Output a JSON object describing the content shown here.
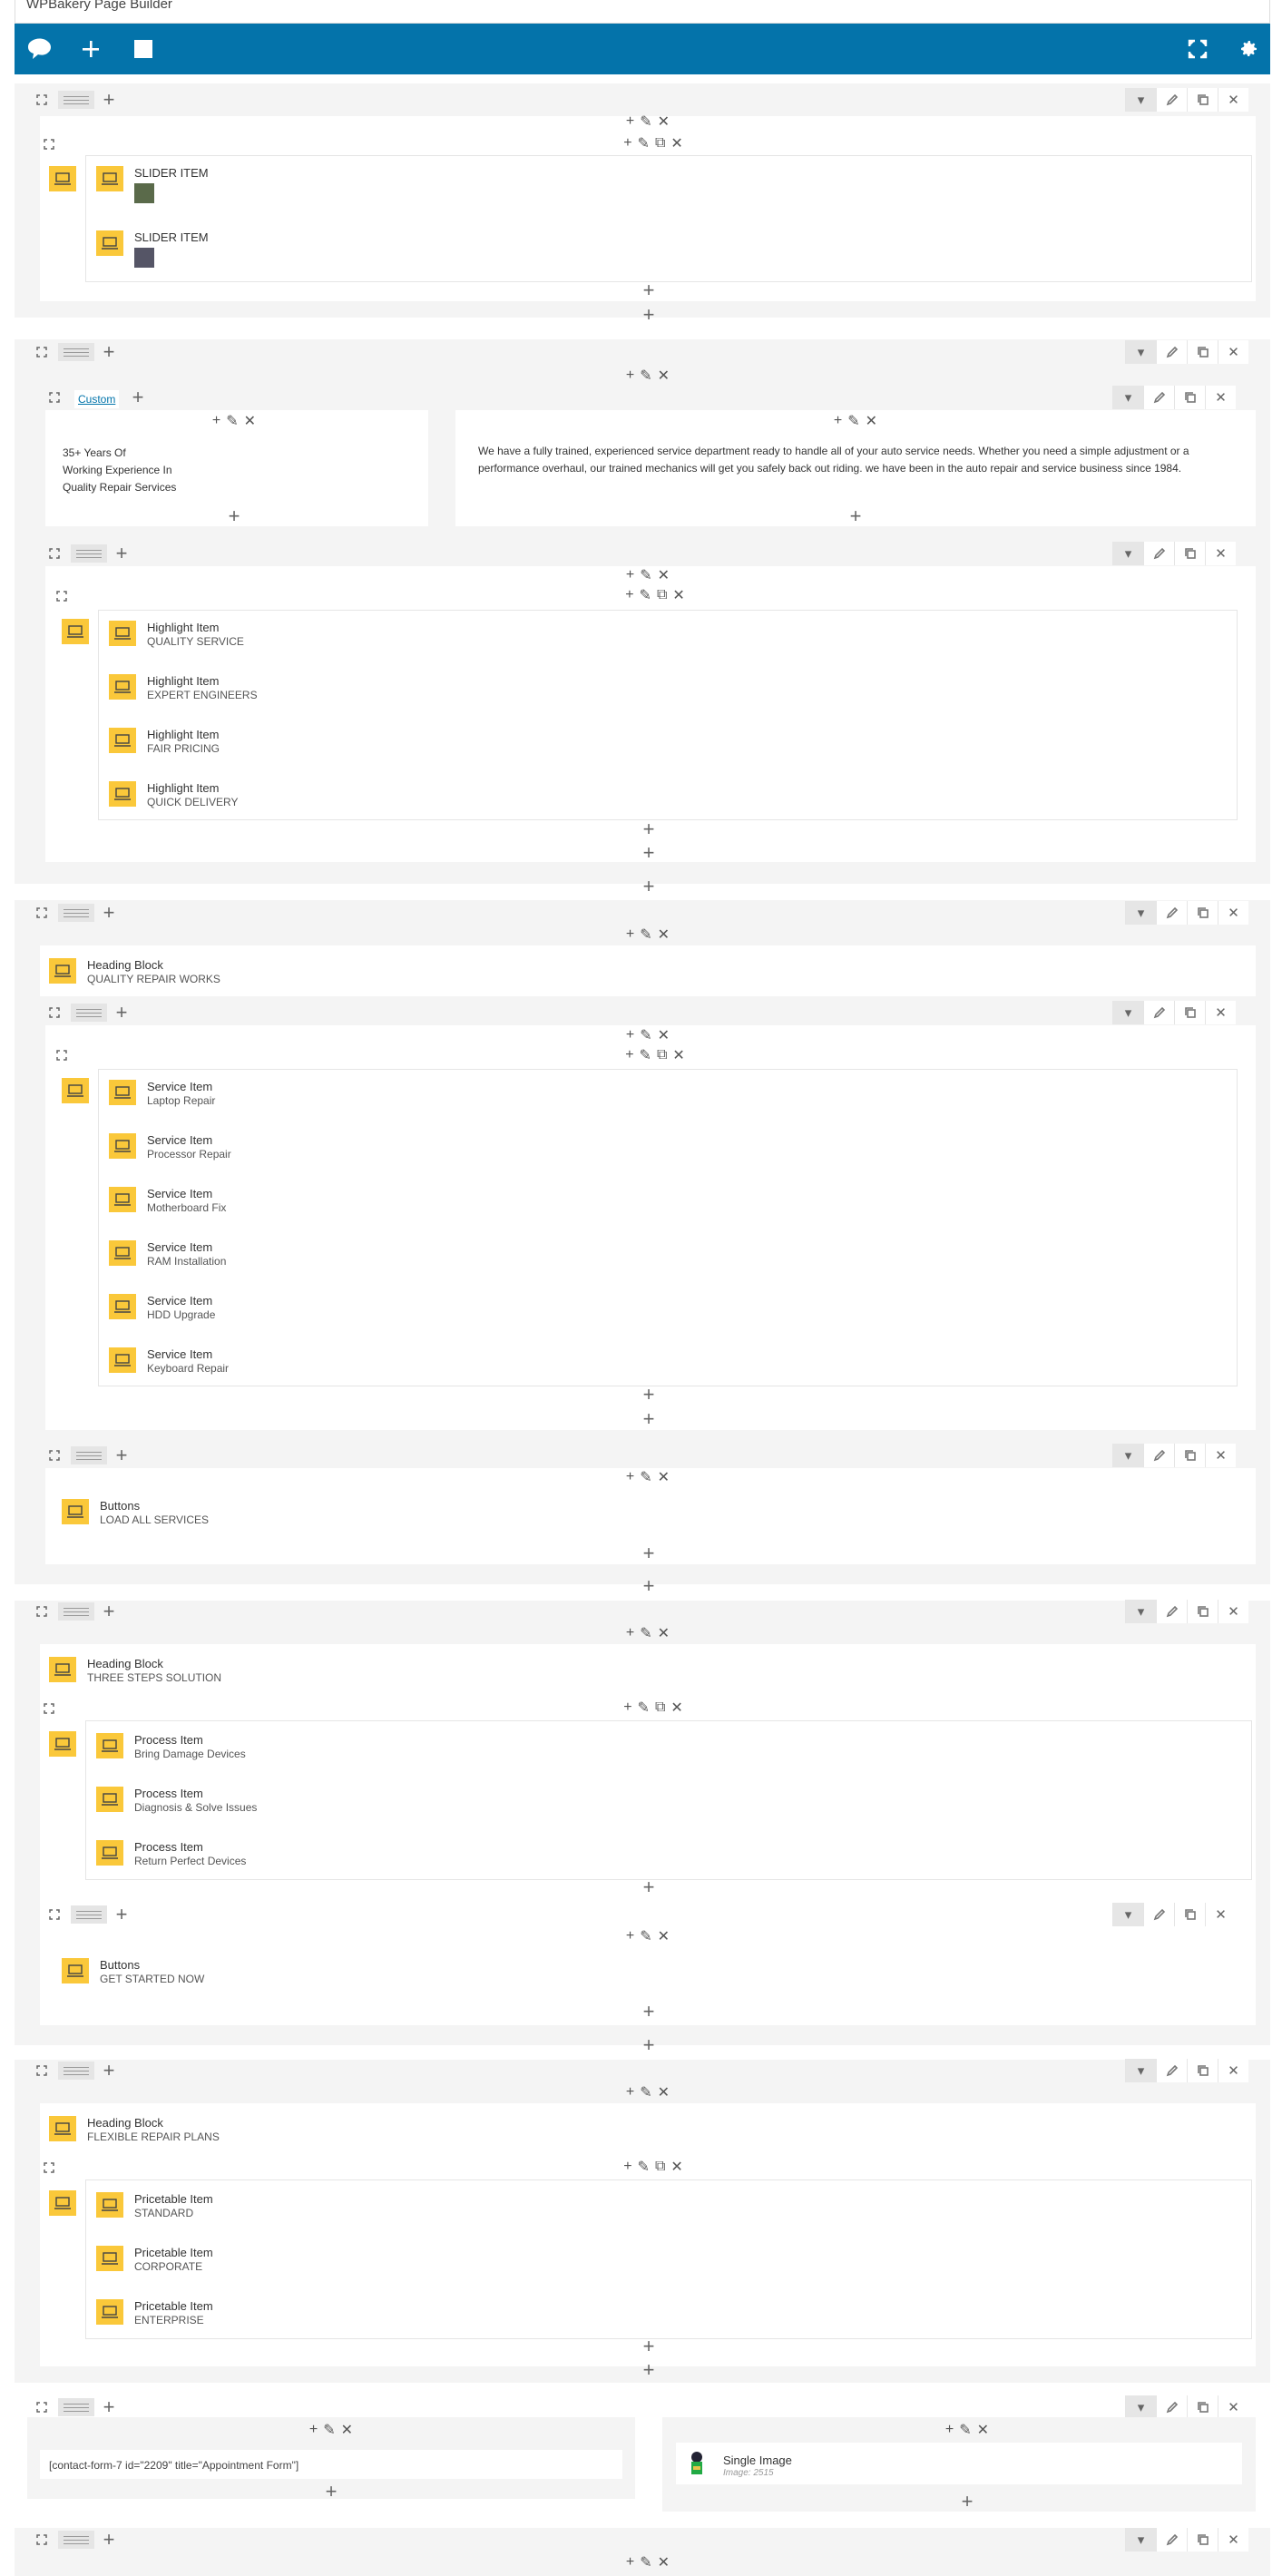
{
  "app": {
    "title": "WPBakery Page Builder"
  },
  "sliders": [
    {
      "label": "SLIDER ITEM"
    },
    {
      "label": "SLIDER ITEM"
    }
  ],
  "about": {
    "tab": "Custom",
    "left_text": [
      "35+ Years Of",
      "Working Experience In",
      "Quality Repair Services"
    ],
    "right_text": "We have a fully trained, experienced service department ready to handle all of your auto service needs. Whether you need a simple adjustment or a performance overhaul, our trained mechanics will get you safely back out riding. we have been in the auto repair and service business since 1984."
  },
  "highlights": [
    {
      "type": "Highlight Item",
      "title": "QUALITY SERVICE"
    },
    {
      "type": "Highlight Item",
      "title": "EXPERT ENGINEERS"
    },
    {
      "type": "Highlight Item",
      "title": "FAIR PRICING"
    },
    {
      "type": "Highlight Item",
      "title": "QUICK DELIVERY"
    }
  ],
  "heading1": {
    "type": "Heading Block",
    "title": "QUALITY REPAIR WORKS"
  },
  "services": [
    {
      "type": "Service Item",
      "title": "Laptop Repair"
    },
    {
      "type": "Service Item",
      "title": "Processor Repair"
    },
    {
      "type": "Service Item",
      "title": "Motherboard Fix"
    },
    {
      "type": "Service Item",
      "title": "RAM Installation"
    },
    {
      "type": "Service Item",
      "title": "HDD Upgrade"
    },
    {
      "type": "Service Item",
      "title": "Keyboard Repair"
    }
  ],
  "buttons1": {
    "type": "Buttons",
    "title": "LOAD ALL SERVICES"
  },
  "heading2": {
    "type": "Heading Block",
    "title": "THREE STEPS SOLUTION"
  },
  "process": [
    {
      "type": "Process Item",
      "title": "Bring Damage Devices"
    },
    {
      "type": "Process Item",
      "title": "Diagnosis & Solve Issues"
    },
    {
      "type": "Process Item",
      "title": "Return Perfect Devices"
    }
  ],
  "buttons2": {
    "type": "Buttons",
    "title": "GET STARTED NOW"
  },
  "heading3": {
    "type": "Heading Block",
    "title": "FLEXIBLE REPAIR PLANS"
  },
  "pricing": [
    {
      "type": "Pricetable Item",
      "title": "STANDARD"
    },
    {
      "type": "Pricetable Item",
      "title": "CORPORATE"
    },
    {
      "type": "Pricetable Item",
      "title": "ENTERPRISE"
    }
  ],
  "contact": {
    "shortcode": "[contact-form-7 id=\"2209\" title=\"Appointment Form\"]"
  },
  "single_image": {
    "type": "Single Image",
    "caption": "Image: 2515"
  },
  "colors": {
    "brand": "#0473aa",
    "element_icon": "#fac83a"
  }
}
